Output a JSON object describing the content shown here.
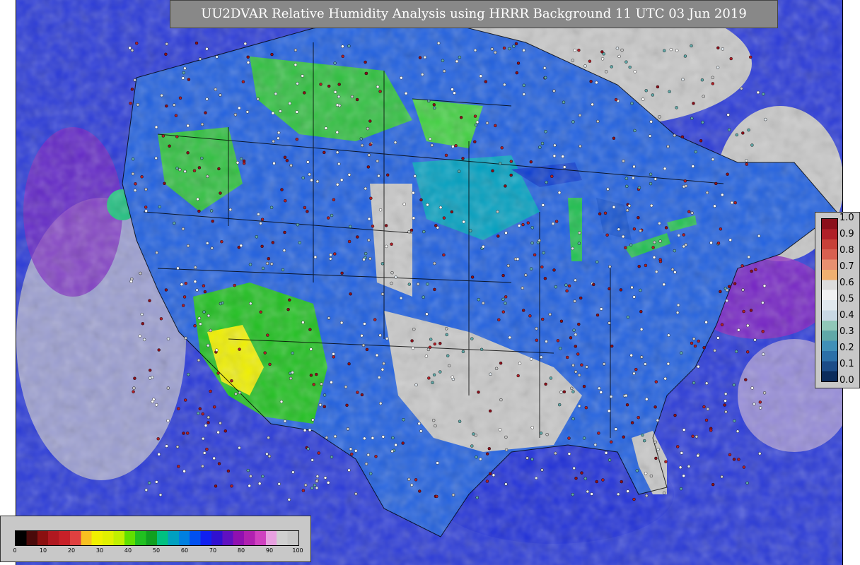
{
  "title": "UU2DVAR Relative Humidity Analysis using HRRR Background 11 UTC 03 Jun 2019",
  "innovation_legend": {
    "ticks": [
      "1.0",
      "0.9",
      "0.8",
      "0.7",
      "0.6",
      "0.5",
      "0.4",
      "0.3",
      "0.2",
      "0.1",
      "0.0"
    ],
    "colors": [
      "#8b0f1a",
      "#b02028",
      "#c84038",
      "#d86050",
      "#e89070",
      "#f0b070",
      "#dcdcdc",
      "#f2f2f2",
      "#e0e8ee",
      "#c8d8e4",
      "#90c8b8",
      "#60a8a8",
      "#4090b8",
      "#2c70a8",
      "#1c4c88",
      "#0c2c5c"
    ]
  },
  "rh_legend": {
    "ticks": [
      "0",
      "10",
      "20",
      "30",
      "40",
      "50",
      "60",
      "70",
      "80",
      "90",
      "100"
    ],
    "colors": [
      "#000000",
      "#4a0a0a",
      "#8b1010",
      "#b01820",
      "#c82028",
      "#e04040",
      "#f8c020",
      "#f0f000",
      "#e0f000",
      "#c0f000",
      "#60e000",
      "#20c020",
      "#10a020",
      "#00c080",
      "#00a0c0",
      "#0080e0",
      "#0050f0",
      "#1020f0",
      "#3010d0",
      "#6010c0",
      "#9010b0",
      "#b020b0",
      "#d040c0",
      "#e8a0e0",
      "#d0d0d0",
      "#c8c8c8"
    ]
  },
  "map": {
    "ocean_color": "#2a3ad8",
    "land_base_color": "#2060e0",
    "borders_color": "#000000"
  }
}
